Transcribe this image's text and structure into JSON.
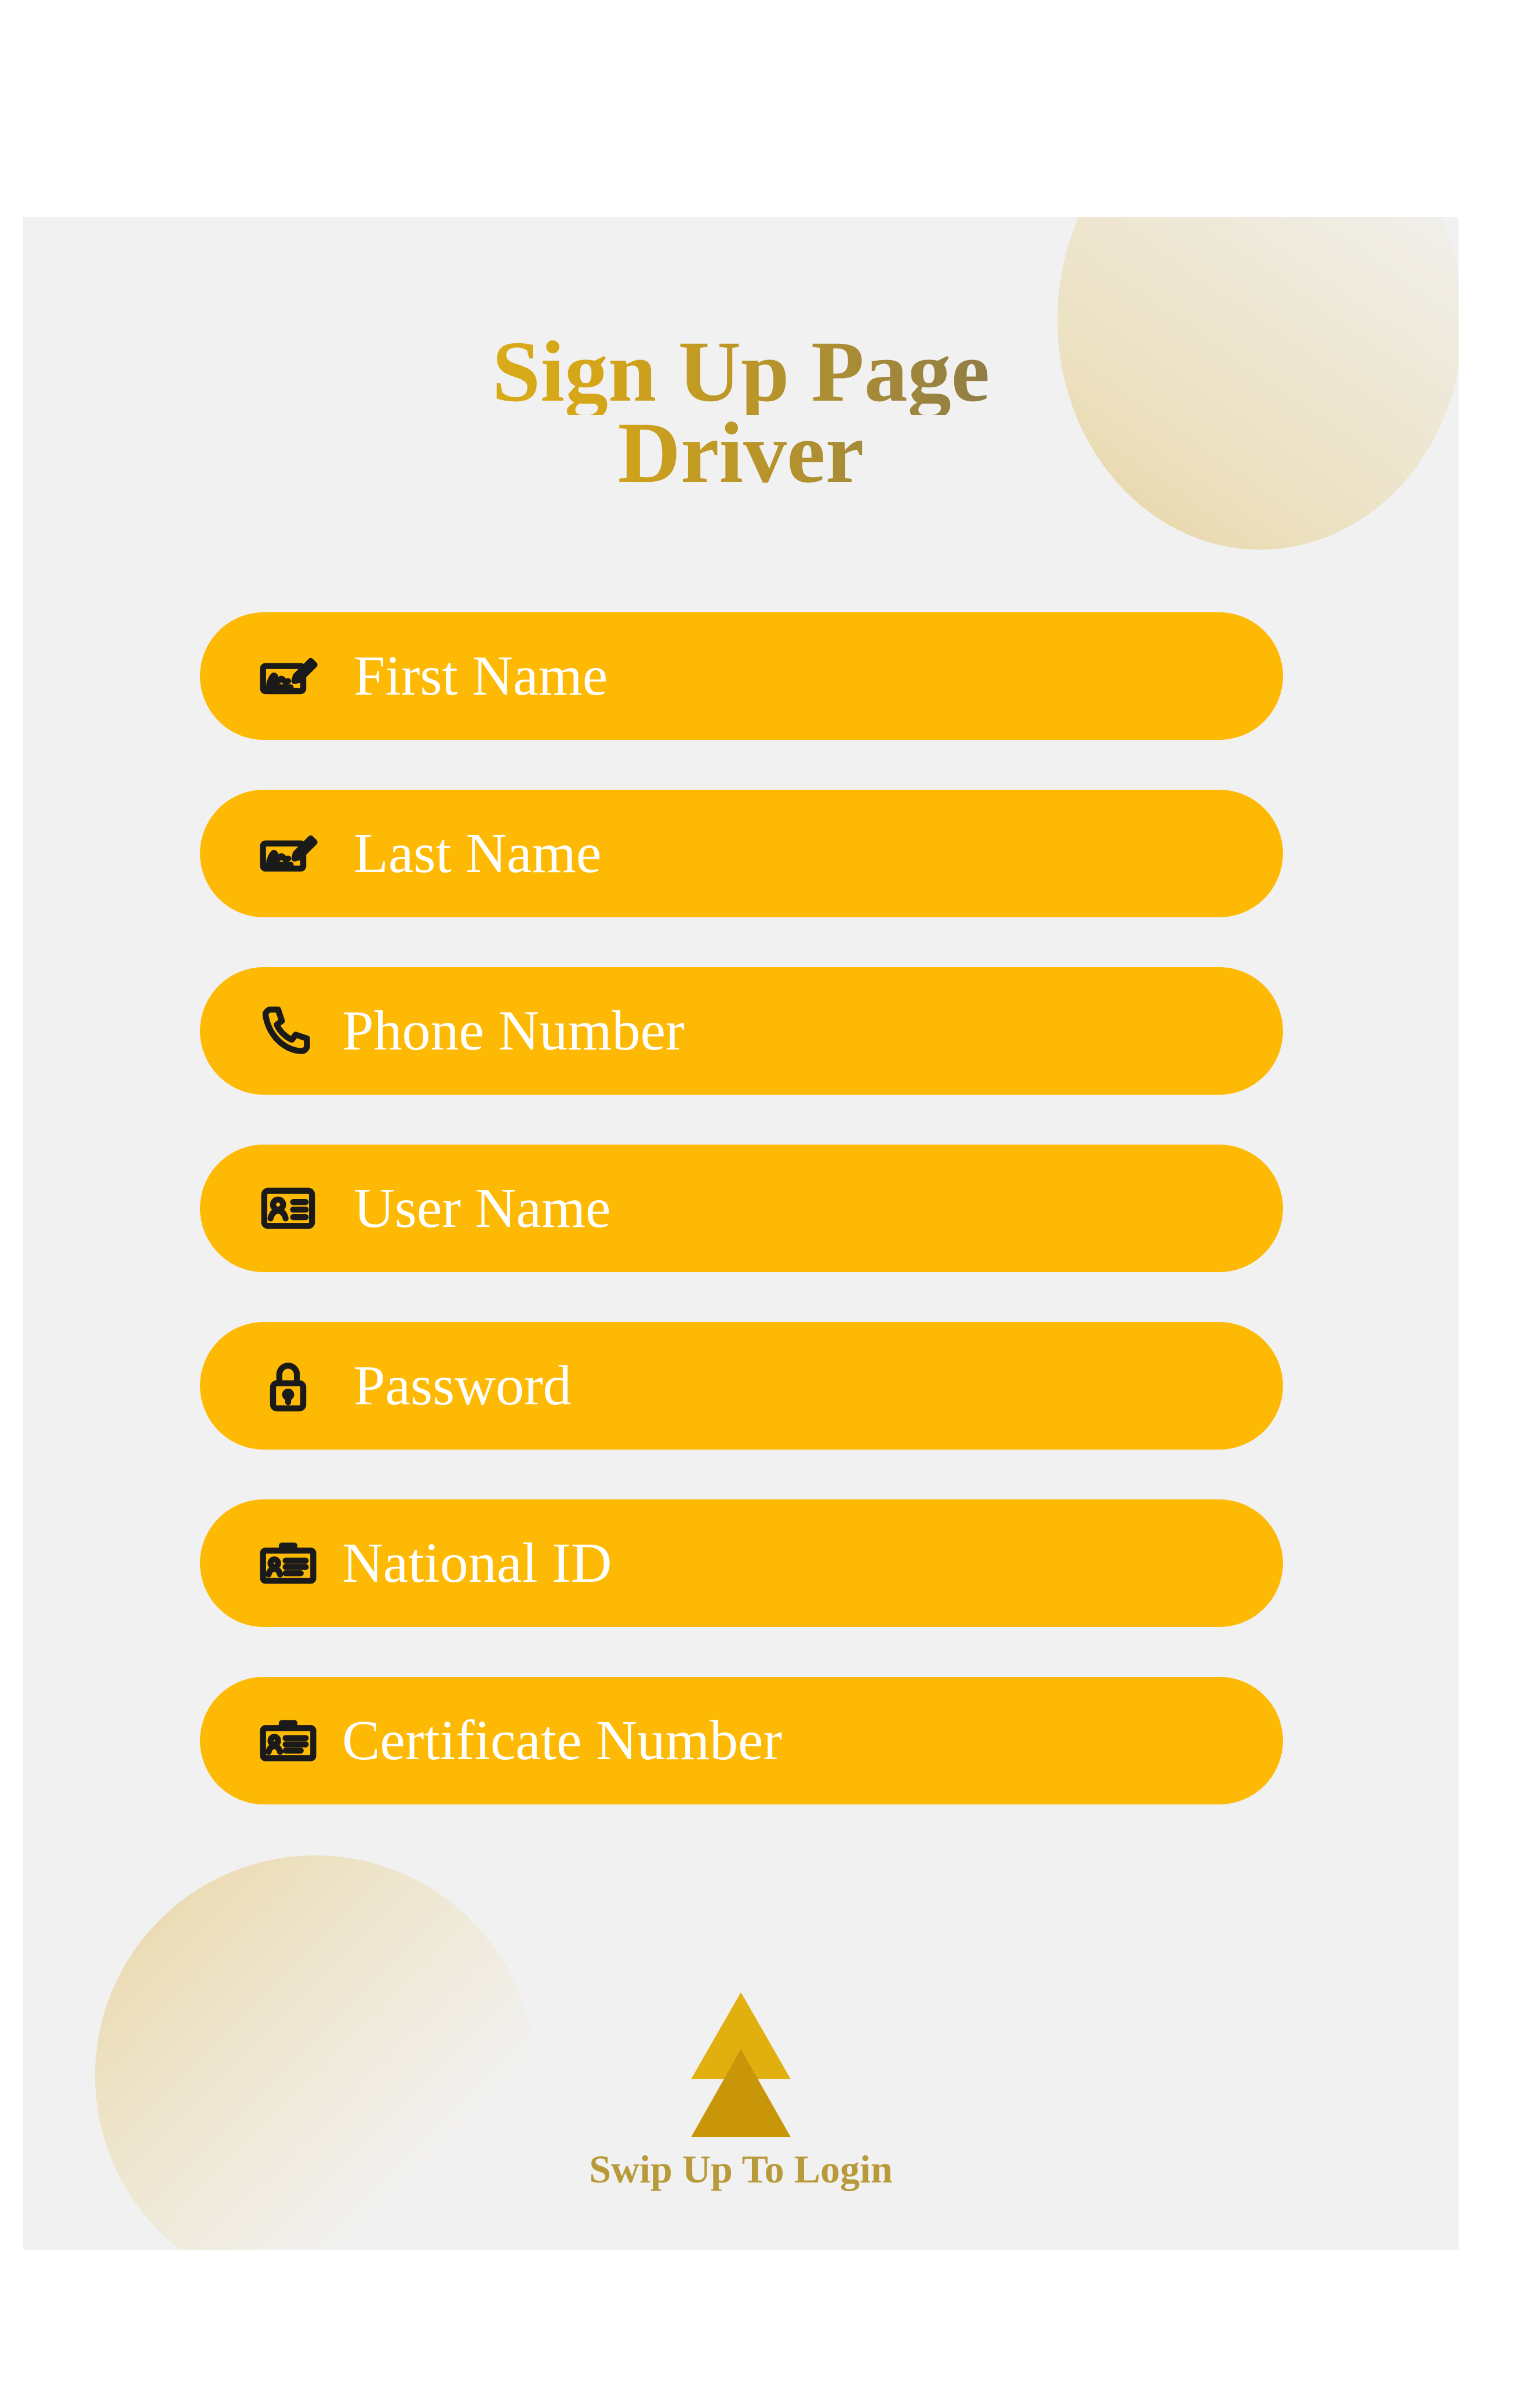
{
  "title": {
    "line1": "Sign Up Page",
    "line2": "Driver"
  },
  "fields": [
    {
      "label": "First Name",
      "icon": "signature-icon"
    },
    {
      "label": "Last Name",
      "icon": "signature-icon"
    },
    {
      "label": "Phone Number",
      "icon": "phone-icon"
    },
    {
      "label": "User Name",
      "icon": "id-card-icon"
    },
    {
      "label": "Password",
      "icon": "lock-icon"
    },
    {
      "label": "National ID",
      "icon": "badge-icon"
    },
    {
      "label": "Certificate Number",
      "icon": "badge-icon"
    }
  ],
  "footer": {
    "swipe_label": "Swip Up To Login",
    "icon": "double-up-arrow-icon"
  },
  "colors": {
    "field_background": "#fdb904",
    "field_text": "#ffffff",
    "panel_background": "#f1f1f1",
    "title_gradient_start": "#f4c414",
    "title_gradient_end": "#605a4c",
    "swipe_text": "#b89a3a"
  }
}
